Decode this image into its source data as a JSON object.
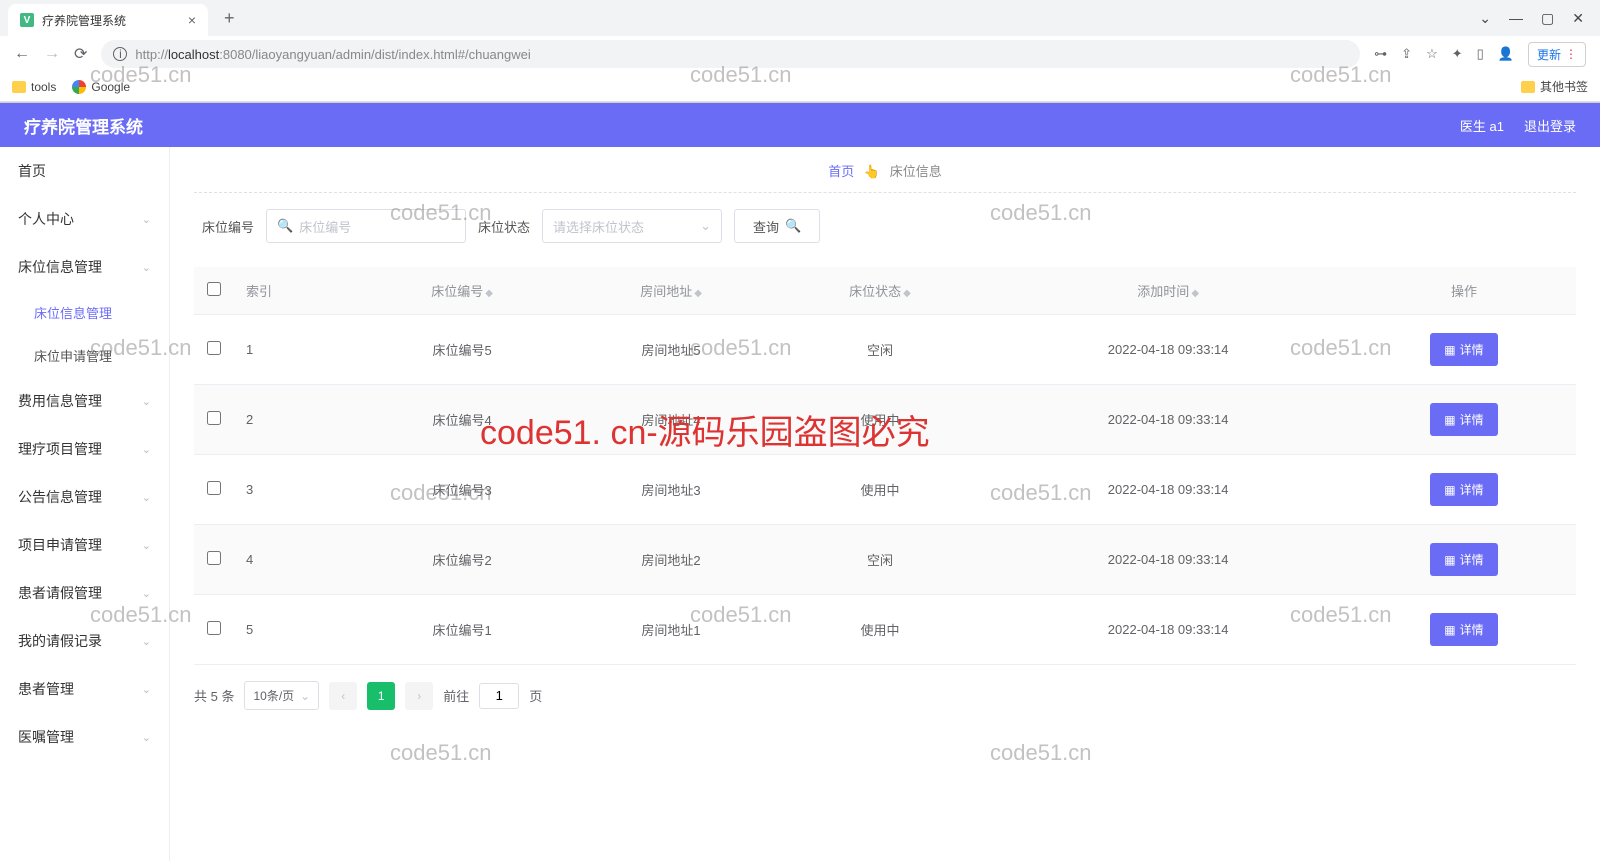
{
  "browser": {
    "tab_title": "疗养院管理系统",
    "url_host": "localhost",
    "url_prefix": "http://",
    "url_port": ":8080",
    "url_path": "/liaoyangyuan/admin/dist/index.html#/chuangwei",
    "update_label": "更新",
    "bookmarks": {
      "tools": "tools",
      "google": "Google",
      "other": "其他书签"
    }
  },
  "header": {
    "title": "疗养院管理系统",
    "user": "医生 a1",
    "logout": "退出登录"
  },
  "sidebar": {
    "items": [
      {
        "label": "首页",
        "has_arrow": false
      },
      {
        "label": "个人中心",
        "has_arrow": true
      },
      {
        "label": "床位信息管理",
        "has_arrow": true,
        "expanded": true,
        "children": [
          {
            "label": "床位信息管理",
            "active": true
          },
          {
            "label": "床位申请管理",
            "active": false
          }
        ]
      },
      {
        "label": "费用信息管理",
        "has_arrow": true
      },
      {
        "label": "理疗项目管理",
        "has_arrow": true
      },
      {
        "label": "公告信息管理",
        "has_arrow": true
      },
      {
        "label": "项目申请管理",
        "has_arrow": true
      },
      {
        "label": "患者请假管理",
        "has_arrow": true
      },
      {
        "label": "我的请假记录",
        "has_arrow": true
      },
      {
        "label": "患者管理",
        "has_arrow": true
      },
      {
        "label": "医嘱管理",
        "has_arrow": true
      }
    ]
  },
  "breadcrumb": {
    "home": "首页",
    "current": "床位信息"
  },
  "filters": {
    "bed_label": "床位编号",
    "bed_placeholder": "床位编号",
    "status_label": "床位状态",
    "status_placeholder": "请选择床位状态",
    "query_btn": "查询"
  },
  "table": {
    "headers": {
      "index": "索引",
      "bed_no": "床位编号",
      "room_addr": "房间地址",
      "status": "床位状态",
      "add_time": "添加时间",
      "action": "操作"
    },
    "detail_btn": "详情",
    "rows": [
      {
        "idx": "1",
        "bed": "床位编号5",
        "room": "房间地址5",
        "status": "空闲",
        "time": "2022-04-18 09:33:14"
      },
      {
        "idx": "2",
        "bed": "床位编号4",
        "room": "房间地址4",
        "status": "使用中",
        "time": "2022-04-18 09:33:14"
      },
      {
        "idx": "3",
        "bed": "床位编号3",
        "room": "房间地址3",
        "status": "使用中",
        "time": "2022-04-18 09:33:14"
      },
      {
        "idx": "4",
        "bed": "床位编号2",
        "room": "房间地址2",
        "status": "空闲",
        "time": "2022-04-18 09:33:14"
      },
      {
        "idx": "5",
        "bed": "床位编号1",
        "room": "房间地址1",
        "status": "使用中",
        "time": "2022-04-18 09:33:14"
      }
    ]
  },
  "pagination": {
    "total": "共 5 条",
    "per_page": "10条/页",
    "current": "1",
    "goto_prefix": "前往",
    "goto_suffix": "页",
    "goto_value": "1"
  },
  "watermarks": {
    "small": "code51.cn",
    "big": "code51. cn-源码乐园盗图必究"
  }
}
